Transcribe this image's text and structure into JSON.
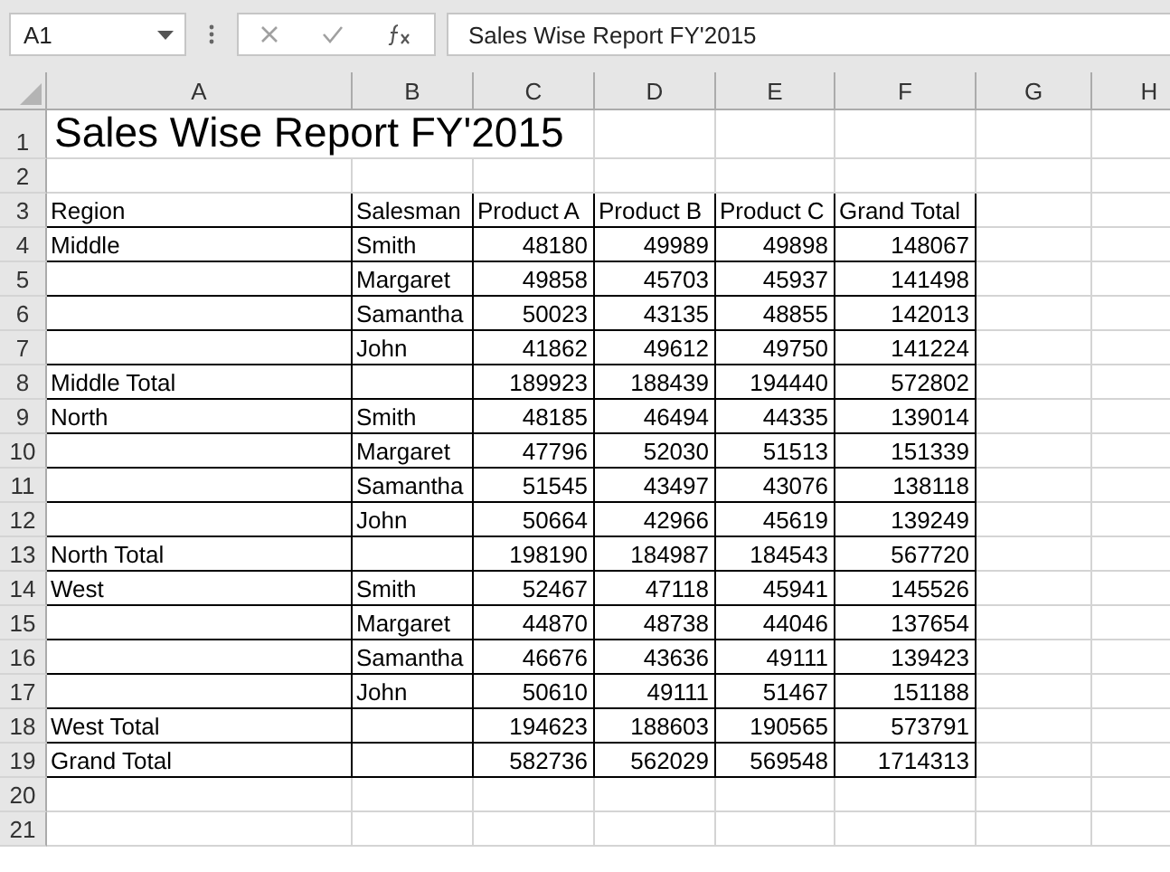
{
  "formula_bar": {
    "name_box": "A1",
    "formula": "Sales Wise Report FY'2015"
  },
  "column_headers": [
    "A",
    "B",
    "C",
    "D",
    "E",
    "F",
    "G",
    "H"
  ],
  "row_headers": [
    "1",
    "2",
    "3",
    "4",
    "5",
    "6",
    "7",
    "8",
    "9",
    "10",
    "11",
    "12",
    "13",
    "14",
    "15",
    "16",
    "17",
    "18",
    "19",
    "20",
    "21"
  ],
  "title": "Sales Wise Report FY'2015",
  "table": {
    "columns": [
      "Region",
      "Salesman",
      "Product A",
      "Product B",
      "Product C",
      "Grand Total"
    ],
    "rows": [
      [
        "Middle",
        "Smith",
        "48180",
        "49989",
        "49898",
        "148067"
      ],
      [
        "",
        "Margaret",
        "49858",
        "45703",
        "45937",
        "141498"
      ],
      [
        "",
        "Samantha",
        "50023",
        "43135",
        "48855",
        "142013"
      ],
      [
        "",
        "John",
        "41862",
        "49612",
        "49750",
        "141224"
      ],
      [
        "Middle Total",
        "",
        "189923",
        "188439",
        "194440",
        "572802"
      ],
      [
        "North",
        "Smith",
        "48185",
        "46494",
        "44335",
        "139014"
      ],
      [
        "",
        "Margaret",
        "47796",
        "52030",
        "51513",
        "151339"
      ],
      [
        "",
        "Samantha",
        "51545",
        "43497",
        "43076",
        "138118"
      ],
      [
        "",
        "John",
        "50664",
        "42966",
        "45619",
        "139249"
      ],
      [
        "North Total",
        "",
        "198190",
        "184987",
        "184543",
        "567720"
      ],
      [
        "West",
        "Smith",
        "52467",
        "47118",
        "45941",
        "145526"
      ],
      [
        "",
        "Margaret",
        "44870",
        "48738",
        "44046",
        "137654"
      ],
      [
        "",
        "Samantha",
        "46676",
        "43636",
        "49111",
        "139423"
      ],
      [
        "",
        "John",
        "50610",
        "49111",
        "51467",
        "151188"
      ],
      [
        "West Total",
        "",
        "194623",
        "188603",
        "190565",
        "573791"
      ],
      [
        "Grand Total",
        "",
        "582736",
        "562029",
        "569548",
        "1714313"
      ]
    ]
  }
}
